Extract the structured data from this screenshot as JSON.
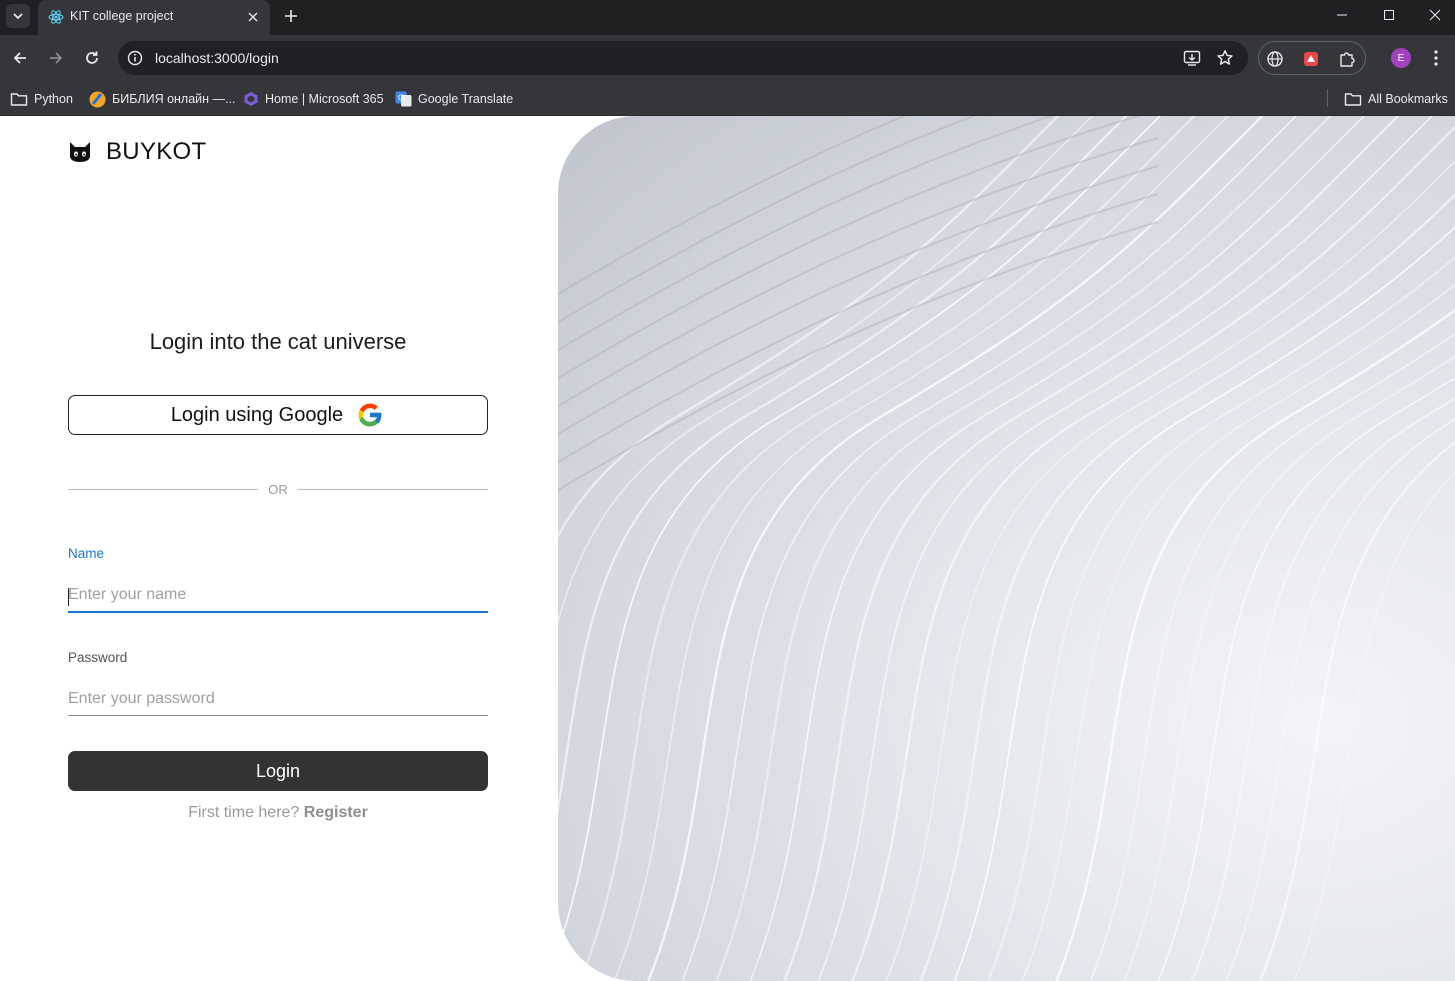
{
  "browser": {
    "tab_title": "KIT college project",
    "url": "localhost:3000/login",
    "profile_initial": "E",
    "bookmarks": [
      {
        "label": "Python",
        "icon": "folder-icon"
      },
      {
        "label": "БИБЛИЯ онлайн —...",
        "icon": "bible-favicon-icon"
      },
      {
        "label": "Home | Microsoft 365",
        "icon": "microsoft-365-icon"
      },
      {
        "label": "Google Translate",
        "icon": "google-translate-icon"
      }
    ],
    "all_bookmarks_label": "All Bookmarks"
  },
  "page": {
    "brand_name": "BUYKOT",
    "brand_icon": "cat-icon",
    "title": "Login into the cat universe",
    "google_button_label": "Login using Google",
    "divider_text": "OR",
    "name": {
      "label": "Name",
      "placeholder": "Enter your name",
      "value": ""
    },
    "password": {
      "label": "Password",
      "placeholder": "Enter your password",
      "value": ""
    },
    "login_button_label": "Login",
    "register_prompt": "First time here?",
    "register_link": "Register"
  },
  "colors": {
    "accent": "#1976d2",
    "button_dark": "#333333",
    "chrome_dark": "#35363a"
  }
}
